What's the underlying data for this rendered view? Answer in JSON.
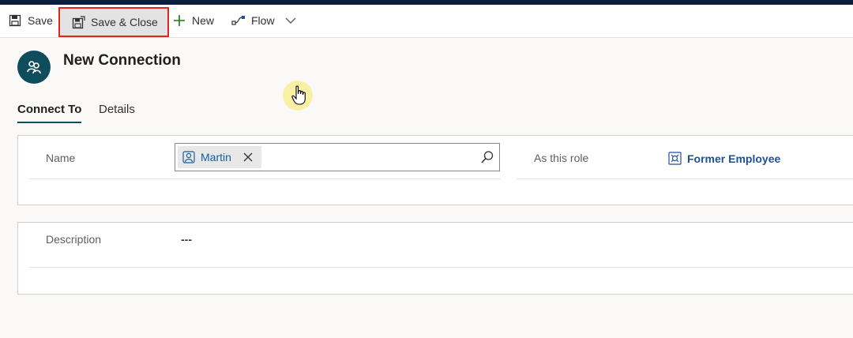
{
  "toolbar": {
    "save_label": "Save",
    "save_close_label": "Save & Close",
    "new_label": "New",
    "flow_label": "Flow"
  },
  "header": {
    "title": "New Connection"
  },
  "tabs": [
    {
      "label": "Connect To",
      "active": true
    },
    {
      "label": "Details",
      "active": false
    }
  ],
  "connect_section": {
    "name_label": "Name",
    "name_value": "Martin",
    "role_label": "As this role",
    "role_value": "Former Employee"
  },
  "details_section": {
    "description_label": "Description",
    "description_value": "---"
  },
  "colors": {
    "accent": "#0f4c5c",
    "link": "#115ea3",
    "highlight_border": "#e3241b"
  }
}
